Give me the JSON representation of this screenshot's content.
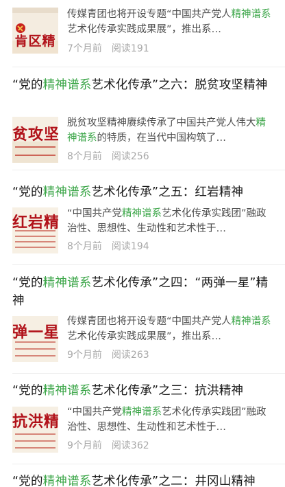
{
  "feed": {
    "articles": [
      {
        "title_pre": "",
        "title_hl": "",
        "title_post": "",
        "thumb_caption": "肯区精",
        "summary_pre": "传媒青团也将开设专题“中国共产党人",
        "summary_hl": "精神谱系",
        "summary_post": "艺术化传承实践成果展”，推出系…",
        "time": "7个月前",
        "reads": "阅读191"
      },
      {
        "title_pre": "“党的",
        "title_hl": "精神谱系",
        "title_post": "艺术化传承”之六：脱贫攻坚精神",
        "thumb_caption": "贫攻坚精",
        "summary_pre": "脱贫攻坚精神赓续传承了中国共产党人伟大",
        "summary_hl": "精神谱系",
        "summary_post": "的特质，在当代中国构筑了…",
        "time": "8个月前",
        "reads": "阅读256"
      },
      {
        "title_pre": "“党的",
        "title_hl": "精神谱系",
        "title_post": "艺术化传承”之五：红岩精神",
        "thumb_caption": "红岩精神",
        "summary_pre": "“中国共产党",
        "summary_hl": "精神谱系",
        "summary_post": "艺术化传承实践团”融政治性、思想性、生动性和艺术性于…",
        "time": "8个月前",
        "reads": "阅读194"
      },
      {
        "title_pre": "“党的",
        "title_hl": "精神谱系",
        "title_post": "艺术化传承”之四：“两弹一星”精神",
        "thumb_caption": "弹一星精",
        "summary_pre": "传媒青团也将开设专题“中国共产党人",
        "summary_hl": "精神谱系",
        "summary_post": "艺术化传承实践成果展”，推出系…",
        "time": "9个月前",
        "reads": "阅读263"
      },
      {
        "title_pre": "“党的",
        "title_hl": "精神谱系",
        "title_post": "艺术化传承”之三：抗洪精神",
        "thumb_caption": "抗洪精神",
        "summary_pre": "“中国共产党",
        "summary_hl": "精神谱系",
        "summary_post": "艺术化传承实践团”融政治性、思想性、生动性和艺术性于…",
        "time": "9个月前",
        "reads": "阅读362"
      },
      {
        "title_pre": "“党的",
        "title_hl": "精神谱系",
        "title_post": "艺术化传承”之二：井冈山精神",
        "thumb_caption": "",
        "summary_pre": "",
        "summary_hl": "",
        "summary_post": "",
        "time": "",
        "reads": ""
      }
    ]
  },
  "colors": {
    "highlight": "#3aa547",
    "title": "#1a1a1a",
    "summary": "#4d4d4d",
    "meta": "#a8a8a8",
    "thumb_red": "#b1121a",
    "thumb_bg": "#f7f1e6"
  }
}
